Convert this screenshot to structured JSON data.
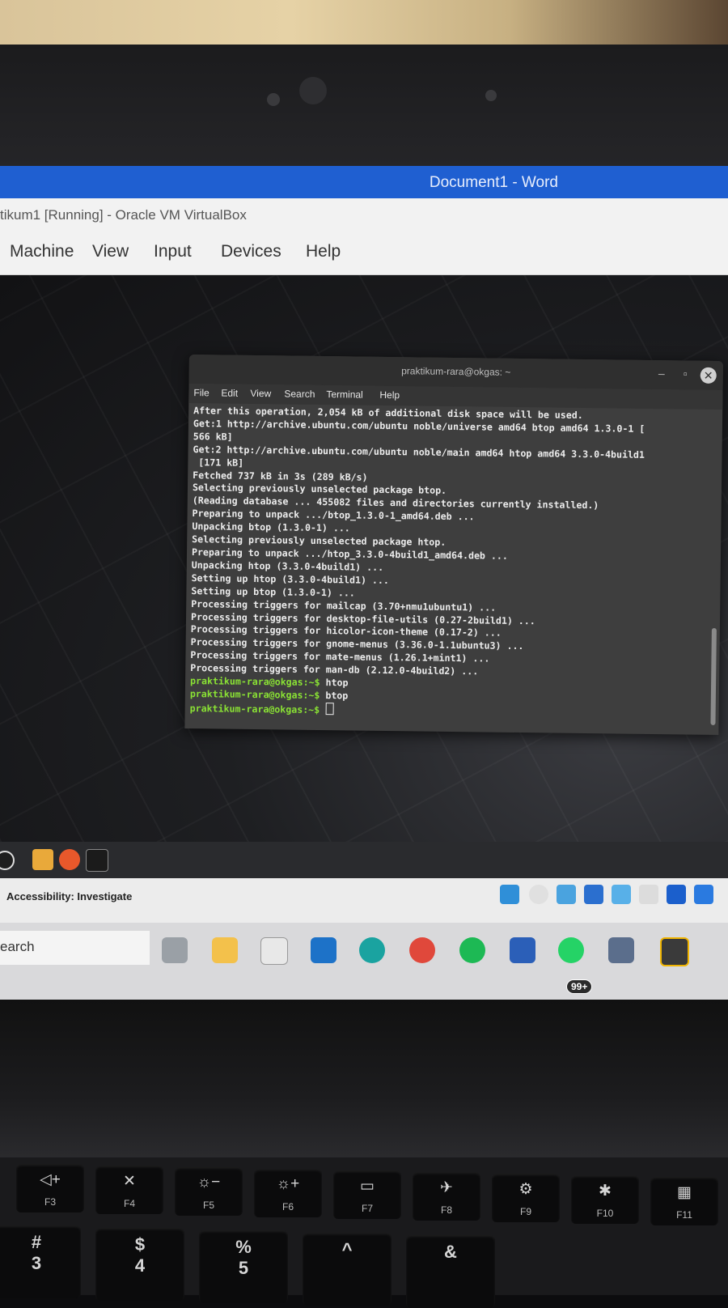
{
  "word": {
    "title": "Document1  -  Word"
  },
  "vbox": {
    "title": "tikum1 [Running] - Oracle VM VirtualBox",
    "menu": [
      "Machine",
      "View",
      "Input",
      "Devices",
      "Help"
    ]
  },
  "terminal": {
    "title": "praktikum-rara@okgas: ~",
    "menu": [
      "File",
      "Edit",
      "View",
      "Search",
      "Terminal",
      "Help"
    ],
    "lines": [
      "After this operation, 2,054 kB of additional disk space will be used.",
      "Get:1 http://archive.ubuntu.com/ubuntu noble/universe amd64 btop amd64 1.3.0-1 [",
      "566 kB]",
      "Get:2 http://archive.ubuntu.com/ubuntu noble/main amd64 htop amd64 3.3.0-4build1",
      " [171 kB]",
      "Fetched 737 kB in 3s (289 kB/s)",
      "Selecting previously unselected package btop.",
      "(Reading database ... 455082 files and directories currently installed.)",
      "Preparing to unpack .../btop_1.3.0-1_amd64.deb ...",
      "Unpacking btop (1.3.0-1) ...",
      "Selecting previously unselected package htop.",
      "Preparing to unpack .../htop_3.3.0-4build1_amd64.deb ...",
      "Unpacking htop (3.3.0-4build1) ...",
      "Setting up htop (3.3.0-4build1) ...",
      "Setting up btop (1.3.0-1) ...",
      "Processing triggers for mailcap (3.70+nmu1ubuntu1) ...",
      "Processing triggers for desktop-file-utils (0.27-2build1) ...",
      "Processing triggers for hicolor-icon-theme (0.17-2) ...",
      "Processing triggers for gnome-menus (3.36.0-1.1ubuntu3) ...",
      "Processing triggers for mate-menus (1.26.1+mint1) ...",
      "Processing triggers for man-db (2.12.0-4build2) ..."
    ],
    "prompt": "praktikum-rara@okgas:~$",
    "commands": [
      "htop",
      "btop",
      ""
    ]
  },
  "vm_panel": {
    "icons": [
      "menu-icon",
      "files-icon",
      "firefox-icon",
      "terminal-icon"
    ]
  },
  "host_status": {
    "accessibility": "Accessibility: Investigate"
  },
  "taskbar": {
    "search_text": "earch",
    "whatsapp_badge": "99+",
    "apps": [
      "task-view-icon",
      "file-explorer-icon",
      "microsoft-store-icon",
      "mail-icon",
      "edge-icon",
      "chrome-icon",
      "spotify-icon",
      "word-icon",
      "whatsapp-icon",
      "virtualbox-icon",
      "vbox-vm-icon"
    ]
  },
  "keyboard": {
    "keys": [
      {
        "sym": "◁+",
        "label": "F3"
      },
      {
        "sym": "✕",
        "label": "F4"
      },
      {
        "sym": "☼−",
        "label": "F5"
      },
      {
        "sym": "☼+",
        "label": "F6"
      },
      {
        "sym": "▭",
        "label": "F7"
      },
      {
        "sym": "✈",
        "label": "F8"
      },
      {
        "sym": "⚙",
        "label": "F9"
      },
      {
        "sym": "✱",
        "label": "F10"
      },
      {
        "sym": "▦",
        "label": "F11"
      }
    ],
    "row2": [
      "#\n3",
      "$\n4",
      "%\n5",
      "^",
      "&"
    ]
  },
  "colors": {
    "prompt": "#8ae234",
    "word_blue": "#1f5fd1"
  }
}
